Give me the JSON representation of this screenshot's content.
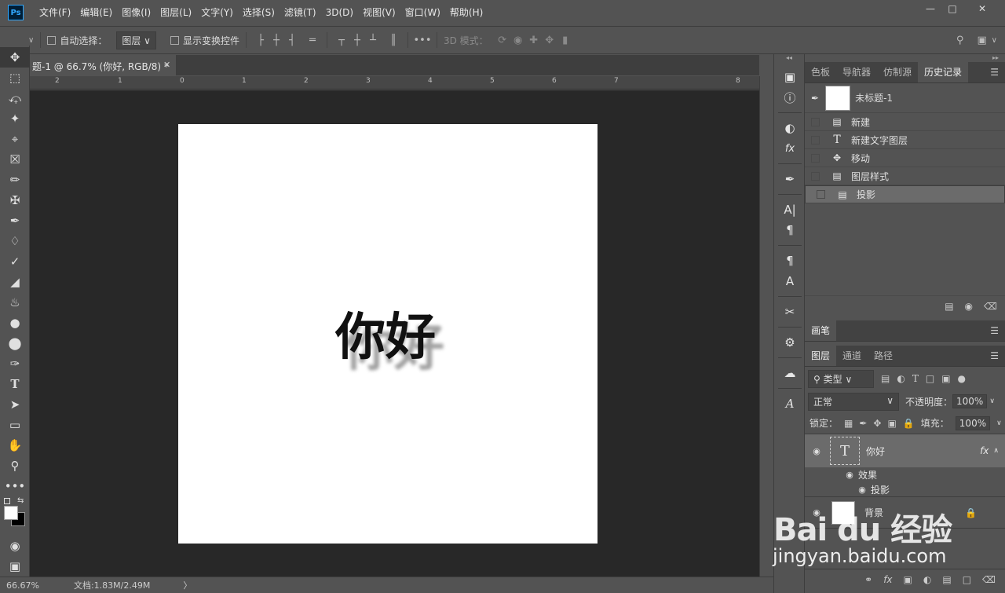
{
  "menubar": {
    "logo": "Ps",
    "items": [
      "文件(F)",
      "编辑(E)",
      "图像(I)",
      "图层(L)",
      "文字(Y)",
      "选择(S)",
      "滤镜(T)",
      "3D(D)",
      "视图(V)",
      "窗口(W)",
      "帮助(H)"
    ]
  },
  "options": {
    "auto_select_label": "自动选择：",
    "auto_select_target": "图层",
    "show_transform_label": "显示变换控件",
    "mode_3d_label": "3D 模式："
  },
  "document": {
    "tab_title": "题-1 @ 66.7% (你好, RGB/8) *",
    "canvas_text": "你好",
    "ruler_numbers": [
      "2",
      "1",
      "0",
      "1",
      "2",
      "3",
      "4",
      "5",
      "6",
      "7",
      "8"
    ]
  },
  "status": {
    "zoom": "66.67%",
    "doc_size": "文档:1.83M/2.49M",
    "arrow": "〉"
  },
  "history_panel": {
    "tabs": [
      "色板",
      "导航器",
      "仿制源",
      "历史记录"
    ],
    "active_tab": "历史记录",
    "snapshot_label": "未标题-1",
    "items": [
      {
        "icon": "document-icon",
        "label": "新建"
      },
      {
        "icon": "type-icon",
        "label": "新建文字图层"
      },
      {
        "icon": "move-icon",
        "label": "移动"
      },
      {
        "icon": "document-icon",
        "label": "图层样式"
      },
      {
        "icon": "document-icon",
        "label": "投影"
      }
    ],
    "selected_index": 4
  },
  "brush_panel": {
    "tab": "画笔"
  },
  "layers_panel": {
    "tabs": [
      "图层",
      "通道",
      "路径"
    ],
    "filter_kind": "类型",
    "blend_mode": "正常",
    "opacity_label": "不透明度：",
    "opacity_value": "100%",
    "lock_label": "锁定：",
    "fill_label": "填充：",
    "fill_value": "100%",
    "layers": [
      {
        "name": "你好",
        "type": "text",
        "fx": "fx",
        "effects_label": "效果",
        "effect": "投影"
      },
      {
        "name": "背景",
        "type": "background",
        "locked": true
      }
    ]
  },
  "watermark": {
    "brand": "Bai du 经验",
    "url": "jingyan.baidu.com"
  }
}
